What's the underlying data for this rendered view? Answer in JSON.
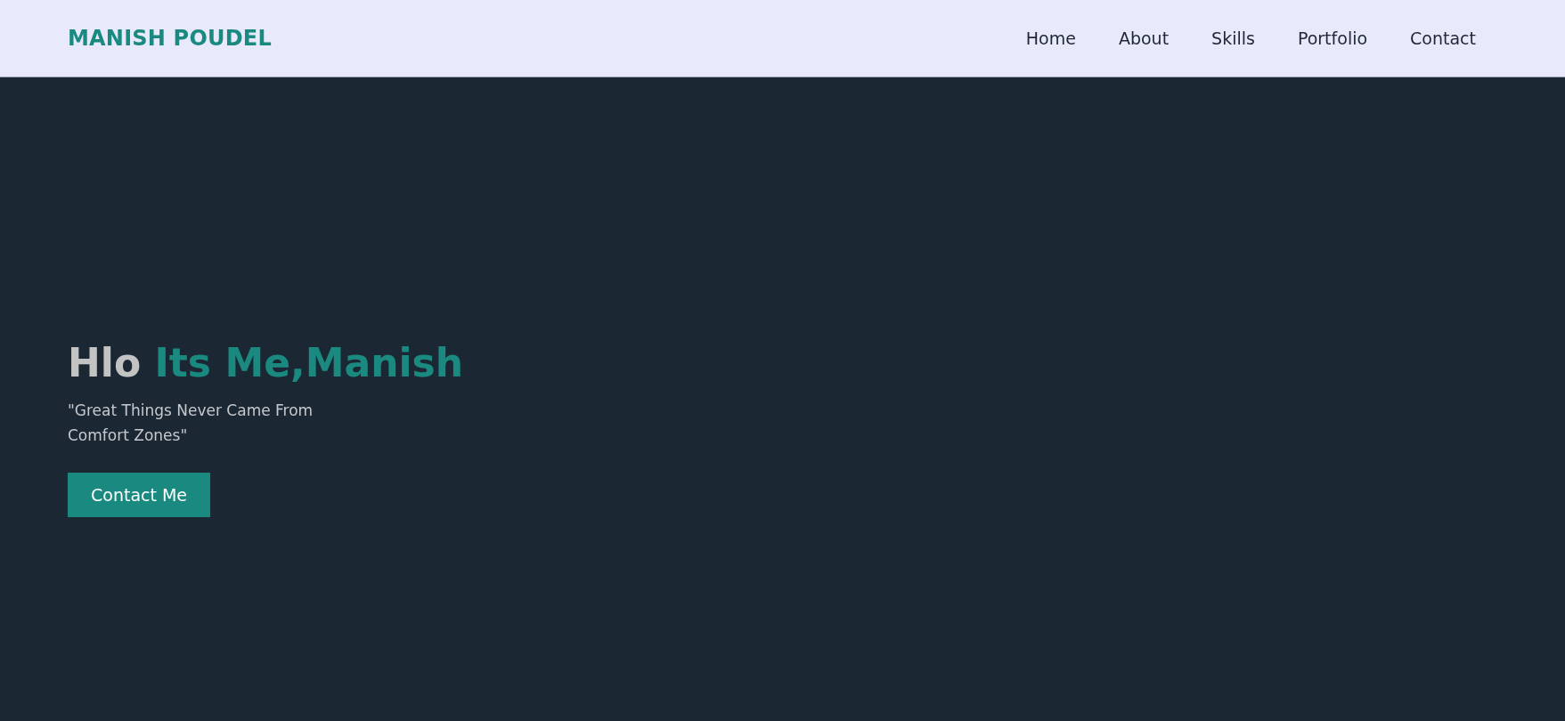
{
  "header": {
    "logo": "MANISH POUDEL",
    "nav": [
      "Home",
      "About",
      "Skills",
      "Portfolio",
      "Contact"
    ]
  },
  "hero": {
    "greeting": "Hlo",
    "highlight": "Its Me,Manish",
    "quote_lines": [
      "\"Great Things Never Came From",
      "Comfort Zones\""
    ],
    "button": "Contact Me"
  }
}
